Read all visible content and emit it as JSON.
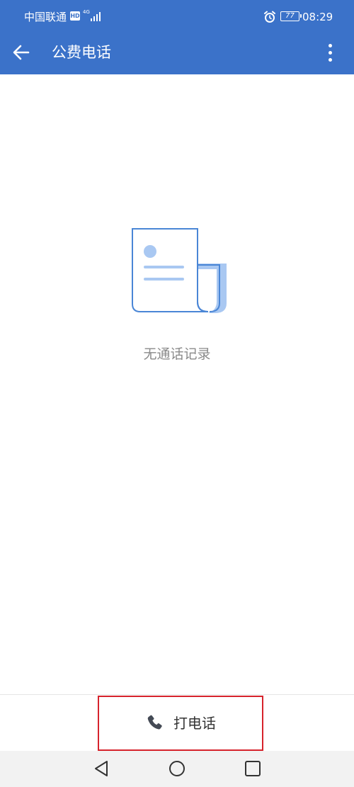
{
  "status_bar": {
    "carrier": "中国联通",
    "hd_badge": "HD",
    "network": "4G",
    "battery": "77",
    "time": "08:29"
  },
  "app_bar": {
    "title": "公费电话"
  },
  "empty_state": {
    "message": "无通话记录"
  },
  "call_bar": {
    "call_label": "打电话"
  },
  "colors": {
    "primary": "#3b72c9",
    "highlight_border": "#d6232c",
    "illustration_line": "#4a86d6",
    "illustration_fill": "#a9c8f2",
    "empty_text": "#8a8a8a"
  },
  "icons": {
    "back": "arrow-left-icon",
    "more": "more-vertical-icon",
    "phone": "phone-icon",
    "nav_back": "triangle-back-icon",
    "nav_home": "circle-home-icon",
    "nav_recent": "square-recent-icon"
  }
}
